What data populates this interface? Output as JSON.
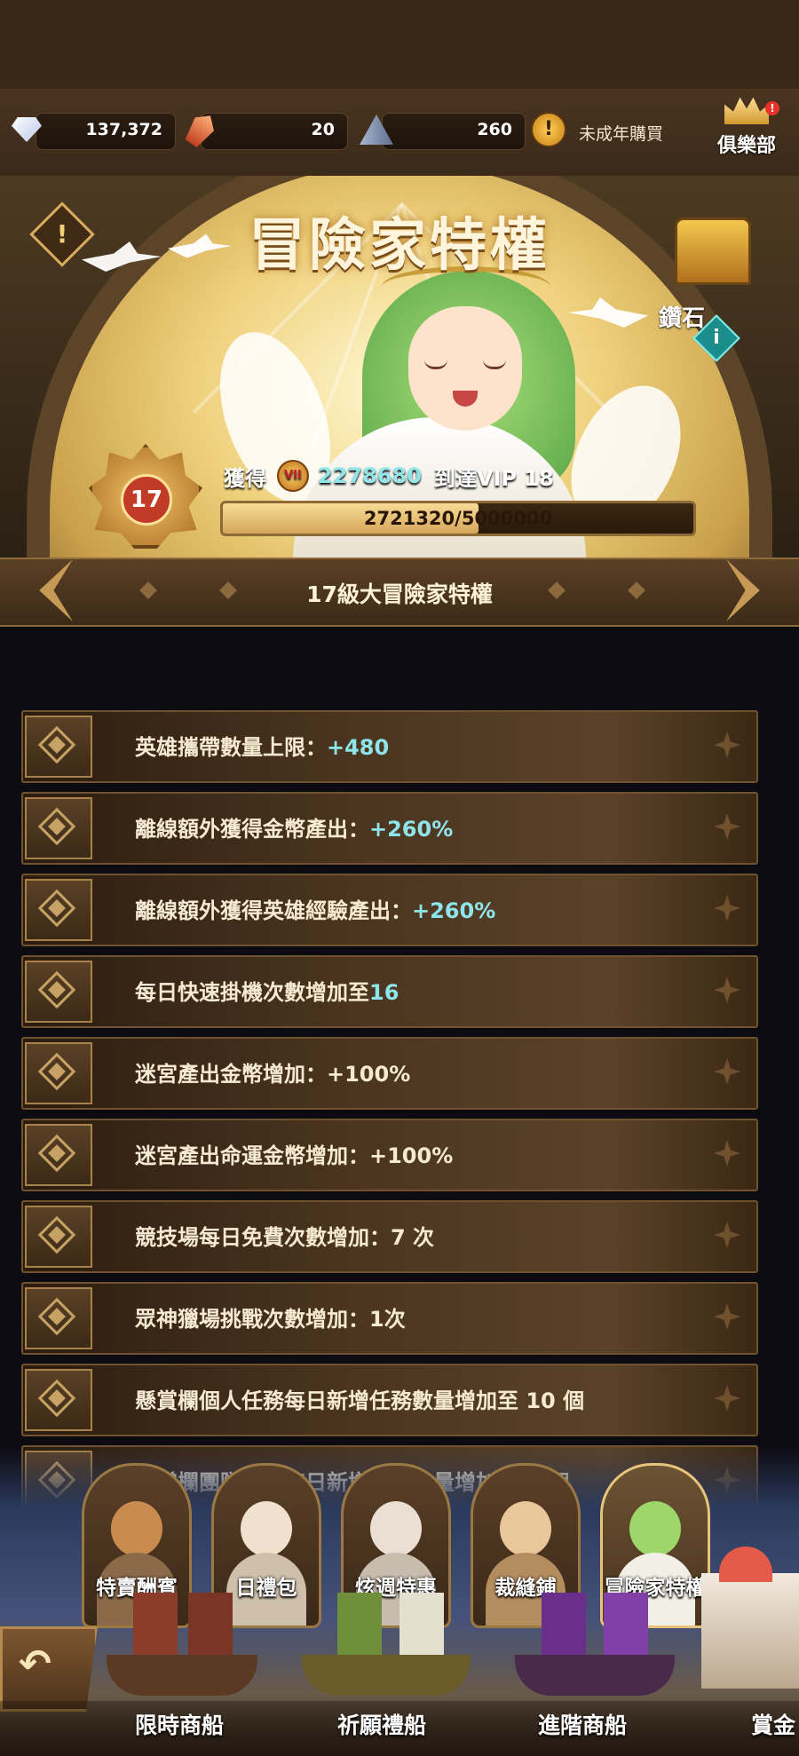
{
  "resources": {
    "diamonds": "137,372",
    "crystals": "20",
    "pyramids": "260",
    "minor_purchase_label": "未成年購買",
    "club_label": "俱樂部",
    "club_badge": "!",
    "coin_glyph": "!"
  },
  "banner": {
    "title": "冒險家特權",
    "warning_glyph": "!",
    "chest_label": "鑽石",
    "info_glyph": "i",
    "vip_level": "17",
    "gain_label": "獲得",
    "gain_medal": "VII",
    "gain_amount": "2278680",
    "gain_target": "到達VIP 18",
    "progress_text": "2721320/5000000",
    "progress_fraction": 0.5443
  },
  "section": {
    "title": "17級大冒險家特權"
  },
  "benefits": [
    {
      "text": "英雄攜帶數量上限：",
      "value": "+480"
    },
    {
      "text": "離線額外獲得金幣產出：",
      "value": "+260%"
    },
    {
      "text": "離線額外獲得英雄經驗產出：",
      "value": "+260%"
    },
    {
      "text": "每日快速掛機次數增加至",
      "value": "16"
    },
    {
      "text": "迷宮產出金幣增加：+100%",
      "value": ""
    },
    {
      "text": "迷宮產出命運金幣增加：+100%",
      "value": ""
    },
    {
      "text": "競技場每日免費次數增加：7 次",
      "value": ""
    },
    {
      "text": "眾神獵場挑戰次數增加：1次",
      "value": ""
    },
    {
      "text": "懸賞欄個人任務每日新增任務數量增加至 10 個",
      "value": ""
    },
    {
      "text": "懸賞欄團隊任務每日新增任務數量增加至 2 個",
      "value": ""
    }
  ],
  "shop_tabs": [
    {
      "label": "特賣酬賓"
    },
    {
      "label": "日禮包"
    },
    {
      "label": "炫週特惠"
    },
    {
      "label": "裁縫鋪"
    },
    {
      "label": "冒險家特權"
    }
  ],
  "ships": [
    {
      "label": "限時商船"
    },
    {
      "label": "祈願禮船"
    },
    {
      "label": "進階商船"
    },
    {
      "label": "賞金"
    }
  ],
  "back_glyph": "↶",
  "colors": {
    "accent_cyan": "#8de5ea",
    "gold": "#c8a264",
    "panel_brown": "#4b3520"
  }
}
